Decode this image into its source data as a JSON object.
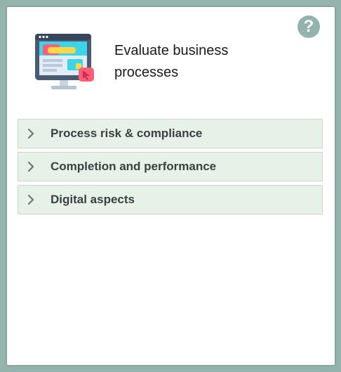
{
  "panel": {
    "title": "Evaluate business processes",
    "help_icon": "question-mark-icon",
    "help_glyph": "?",
    "hero_icon": "web-app-design-icon"
  },
  "accordion": {
    "items": [
      {
        "label": "Process risk & compliance",
        "icon": "chevron-right-icon"
      },
      {
        "label": "Completion and performance",
        "icon": "chevron-right-icon"
      },
      {
        "label": "Digital aspects",
        "icon": "chevron-right-icon"
      }
    ]
  },
  "colors": {
    "background": "#93b3ac",
    "card": "#ffffff",
    "section_fill": "#e6f2e8",
    "section_border": "#c9d6cd",
    "text": "#3c4042"
  }
}
